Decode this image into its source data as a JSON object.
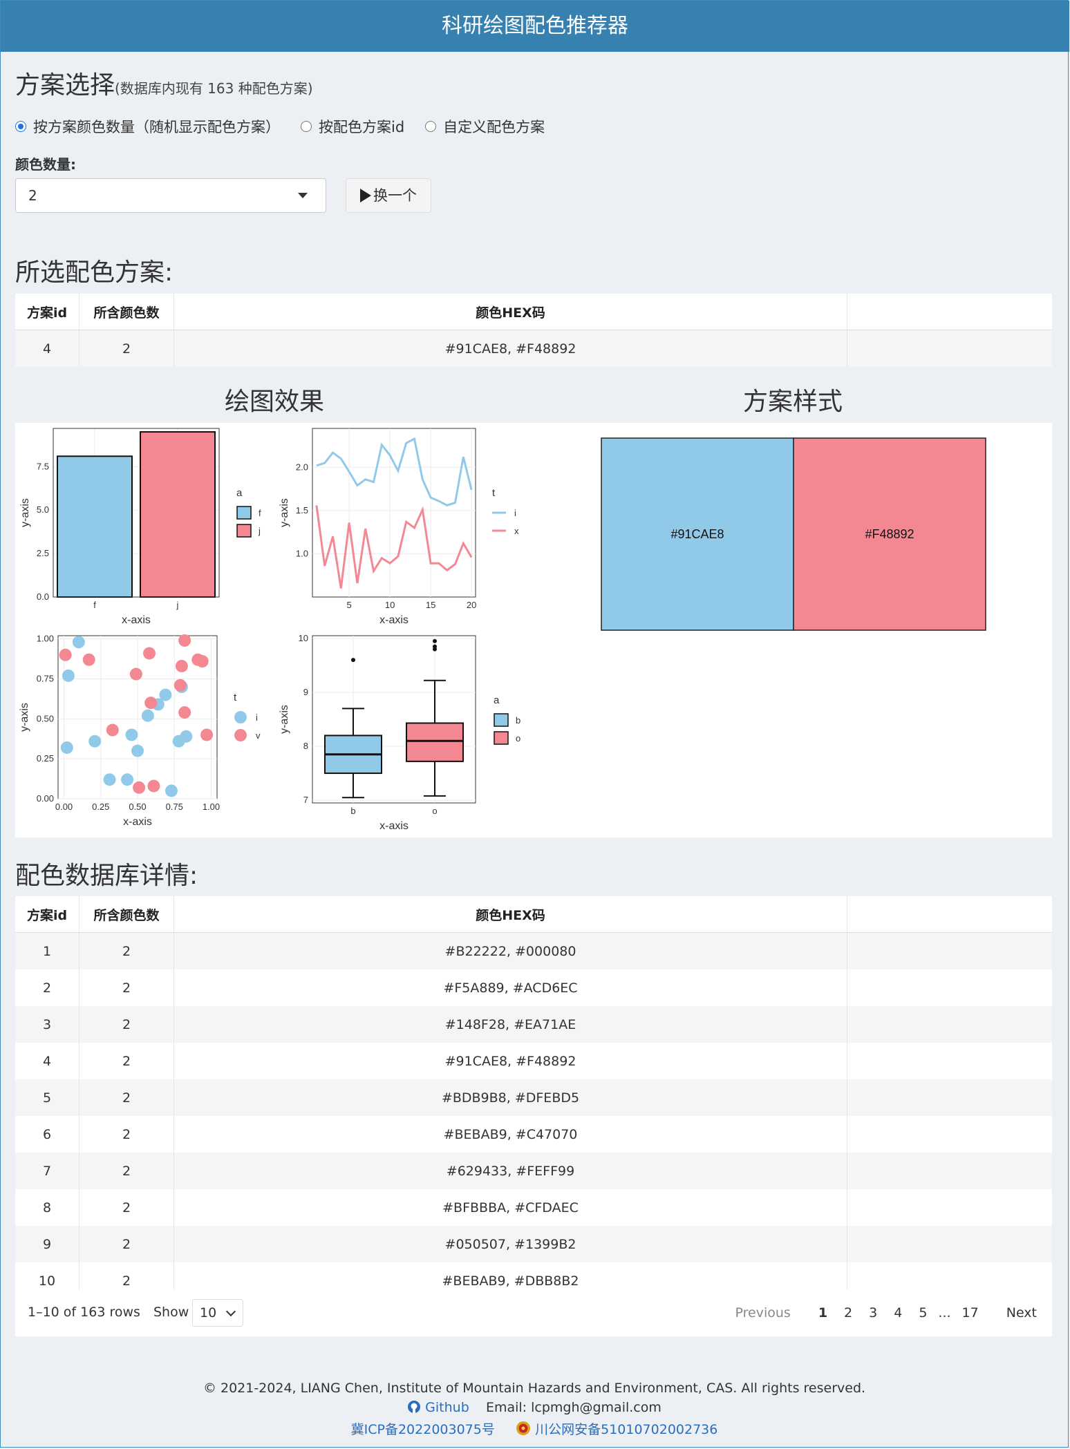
{
  "app": {
    "title": "科研绘图配色推荐器"
  },
  "selection": {
    "heading": "方案选择",
    "subheading": "(数据库内现有 163 种配色方案)",
    "radios": [
      {
        "label": "按方案颜色数量（随机显示配色方案）",
        "checked": true
      },
      {
        "label": "按配色方案id",
        "checked": false
      },
      {
        "label": "自定义配色方案",
        "checked": false
      }
    ],
    "count_label": "颜色数量:",
    "count_value": "2",
    "swap_button": "换一个"
  },
  "selected": {
    "heading": "所选配色方案:",
    "columns": [
      "方案id",
      "所含颜色数",
      "颜色HEX码"
    ],
    "row": {
      "id": "4",
      "count": "2",
      "hex": "#91CAE8, #F48892"
    }
  },
  "plots": {
    "effect_title": "绘图效果",
    "style_title": "方案样式",
    "palette": [
      "#91CAE8",
      "#F48892"
    ],
    "swatches": [
      "#91CAE8",
      "#F48892"
    ]
  },
  "chart_data": [
    {
      "type": "bar",
      "categories": [
        "f",
        "j"
      ],
      "values": [
        8.1,
        9.5
      ],
      "xlabel": "x-axis",
      "ylabel": "y-axis",
      "ylim": [
        0,
        9.7
      ],
      "yticks": [
        "0.0",
        "2.5",
        "5.0",
        "7.5"
      ],
      "legend": {
        "title": "a",
        "entries": [
          "f",
          "j"
        ],
        "position": "right"
      }
    },
    {
      "type": "line",
      "x": [
        1,
        2,
        3,
        4,
        5,
        6,
        7,
        8,
        9,
        10,
        11,
        12,
        13,
        14,
        15,
        16,
        17,
        18,
        19,
        20
      ],
      "series": [
        {
          "name": "i",
          "values": [
            2.02,
            2.05,
            2.17,
            2.1,
            1.95,
            1.79,
            1.86,
            1.83,
            2.26,
            2.14,
            1.96,
            2.28,
            2.33,
            1.86,
            1.65,
            1.61,
            1.56,
            1.59,
            2.12,
            1.74
          ]
        },
        {
          "name": "x",
          "values": [
            1.56,
            0.86,
            1.2,
            0.6,
            1.36,
            0.66,
            1.29,
            0.8,
            0.95,
            0.89,
            0.97,
            1.37,
            1.3,
            1.51,
            0.89,
            0.89,
            0.81,
            0.88,
            1.12,
            0.96
          ]
        }
      ],
      "xlabel": "x-axis",
      "ylabel": "y-axis",
      "xlim": [
        0.5,
        20.5
      ],
      "ylim": [
        0.5,
        2.45
      ],
      "xticks": [
        "5",
        "10",
        "15",
        "20"
      ],
      "yticks": [
        "1.0",
        "1.5",
        "2.0"
      ],
      "legend": {
        "title": "t",
        "entries": [
          "i",
          "x"
        ],
        "position": "right"
      }
    },
    {
      "type": "scatter",
      "series": [
        {
          "name": "i",
          "points": [
            [
              0.02,
              0.32
            ],
            [
              0.03,
              0.77
            ],
            [
              0.1,
              0.98
            ],
            [
              0.21,
              0.36
            ],
            [
              0.31,
              0.12
            ],
            [
              0.43,
              0.12
            ],
            [
              0.46,
              0.4
            ],
            [
              0.5,
              0.3
            ],
            [
              0.57,
              0.52
            ],
            [
              0.64,
              0.59
            ],
            [
              0.69,
              0.65
            ],
            [
              0.73,
              0.05
            ],
            [
              0.78,
              0.36
            ],
            [
              0.8,
              0.7
            ],
            [
              0.83,
              0.39
            ]
          ]
        },
        {
          "name": "v",
          "points": [
            [
              0.01,
              0.9
            ],
            [
              0.17,
              0.87
            ],
            [
              0.33,
              0.43
            ],
            [
              0.49,
              0.78
            ],
            [
              0.51,
              0.07
            ],
            [
              0.58,
              0.91
            ],
            [
              0.59,
              0.6
            ],
            [
              0.61,
              0.08
            ],
            [
              0.79,
              0.71
            ],
            [
              0.8,
              0.83
            ],
            [
              0.82,
              0.54
            ],
            [
              0.82,
              0.99
            ],
            [
              0.91,
              0.87
            ],
            [
              0.94,
              0.86
            ],
            [
              0.97,
              0.4
            ]
          ]
        }
      ],
      "xlabel": "x-axis",
      "ylabel": "y-axis",
      "xlim": [
        -0.04,
        1.04
      ],
      "ylim": [
        0,
        1.02
      ],
      "xticks": [
        "0.00",
        "0.25",
        "0.50",
        "0.75",
        "1.00"
      ],
      "yticks": [
        "0.00",
        "0.25",
        "0.50",
        "0.75",
        "1.00"
      ],
      "legend": {
        "title": "t",
        "entries": [
          "i",
          "v"
        ],
        "position": "right"
      }
    },
    {
      "type": "box",
      "categories": [
        "b",
        "o"
      ],
      "boxes": [
        {
          "min": 7.05,
          "q1": 7.5,
          "median": 7.85,
          "q3": 8.2,
          "max": 8.7,
          "outliers": [
            9.6
          ]
        },
        {
          "min": 7.08,
          "q1": 7.72,
          "median": 8.1,
          "q3": 8.43,
          "max": 9.22,
          "outliers": [
            9.8,
            9.85,
            9.95
          ]
        }
      ],
      "xlabel": "x-axis",
      "ylabel": "y-axis",
      "ylim": [
        6.95,
        10.05
      ],
      "yticks": [
        "7",
        "8",
        "9",
        "10"
      ],
      "legend": {
        "title": "a",
        "entries": [
          "b",
          "o"
        ],
        "position": "right"
      }
    }
  ],
  "database": {
    "heading": "配色数据库详情:",
    "columns": [
      "方案id",
      "所含颜色数",
      "颜色HEX码"
    ],
    "rows": [
      {
        "id": "1",
        "count": "2",
        "hex": "#B22222, #000080"
      },
      {
        "id": "2",
        "count": "2",
        "hex": "#F5A889, #ACD6EC"
      },
      {
        "id": "3",
        "count": "2",
        "hex": "#148F28, #EA71AE"
      },
      {
        "id": "4",
        "count": "2",
        "hex": "#91CAE8, #F48892"
      },
      {
        "id": "5",
        "count": "2",
        "hex": "#BDB9B8, #DFEBD5"
      },
      {
        "id": "6",
        "count": "2",
        "hex": "#BEBAB9, #C47070"
      },
      {
        "id": "7",
        "count": "2",
        "hex": "#629433, #FEFF99"
      },
      {
        "id": "8",
        "count": "2",
        "hex": "#BFBBBA, #CFDAEC"
      },
      {
        "id": "9",
        "count": "2",
        "hex": "#050507, #1399B2"
      },
      {
        "id": "10",
        "count": "2",
        "hex": "#BEBAB9, #DBB8B2"
      }
    ],
    "summary": "1–10 of 163 rows",
    "show_label": "Show",
    "page_size": "10",
    "pager": {
      "previous": "Previous",
      "pages": [
        "1",
        "2",
        "3",
        "4",
        "5"
      ],
      "ellipsis": "...",
      "last": "17",
      "next": "Next"
    }
  },
  "footer": {
    "copyright": "© 2021-2024, LIANG Chen, Institute of Mountain Hazards and Environment, CAS. All rights reserved.",
    "github": "Github",
    "email": "Email: lcpmgh@gmail.com",
    "icp": "冀ICP备2022003075号",
    "police": "川公网安备51010702002736"
  }
}
